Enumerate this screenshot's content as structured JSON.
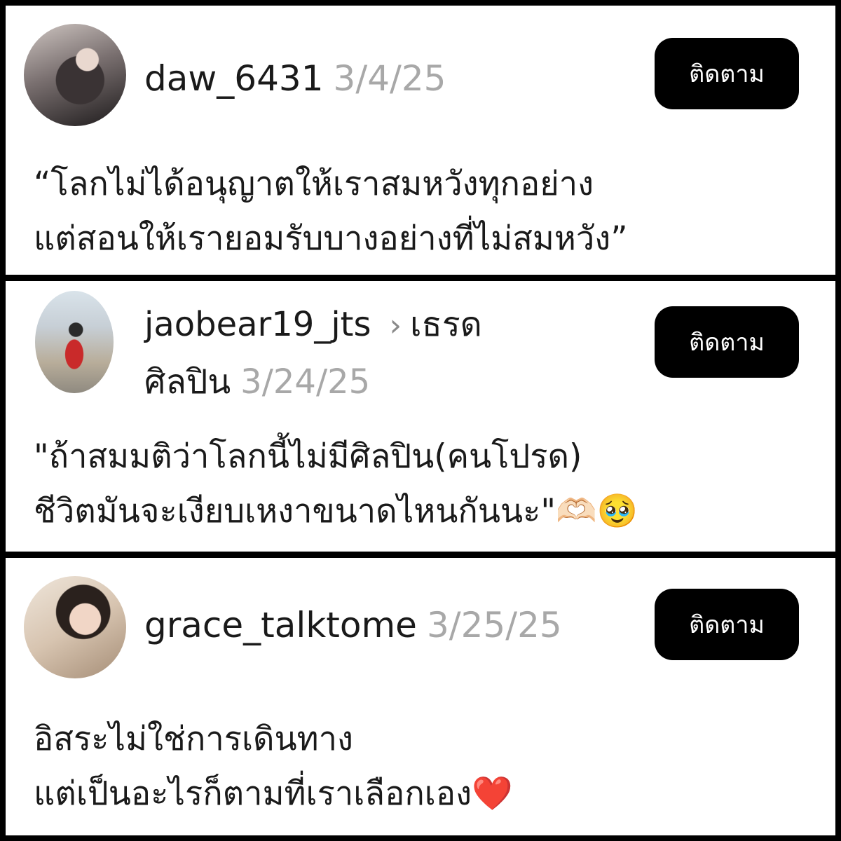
{
  "posts": [
    {
      "username": "daw_6431",
      "date": "3/4/25",
      "follow_label": "ติดตาม",
      "text_lines": [
        "“โลกไม่ได้อนุญาตให้เราสมหวังทุกอย่าง",
        "แต่สอนให้เรายอมรับบางอย่างที่ไม่สมหวัง”"
      ]
    },
    {
      "username": "jaobear19_jts",
      "topic_line1": "เธรด",
      "topic_line2": "ศิลปิน",
      "date": "3/24/25",
      "follow_label": "ติดตาม",
      "text_lines": [
        "\"ถ้าสมมติว่าโลกนี้ไม่มีศิลปิน(คนโปรด)",
        "ชีวิตมันจะเงียบเหงาขนาดไหนกันนะ\"🫶🏻🥹"
      ]
    },
    {
      "username": "grace_talktome",
      "date": "3/25/25",
      "follow_label": "ติดตาม",
      "text_lines": [
        "อิสระไม่ใช่การเดินทาง",
        "แต่เป็นอะไรก็ตามที่เราเลือกเอง❤️"
      ]
    }
  ],
  "icons": {
    "topic_separator": "chevron-right-icon",
    "chevron_glyph": "›"
  }
}
